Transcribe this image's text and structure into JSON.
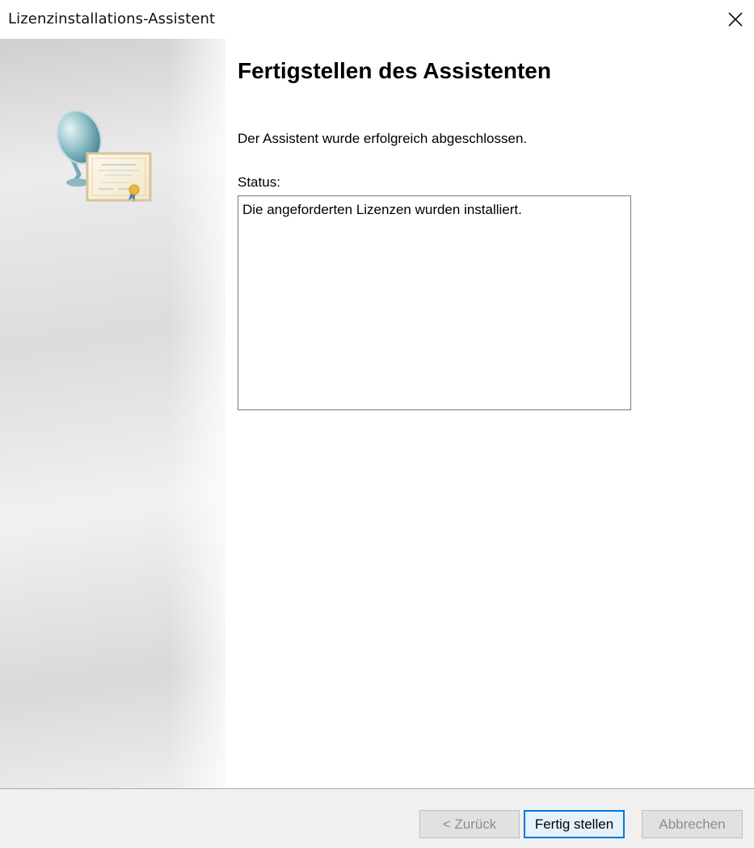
{
  "window": {
    "title": "Lizenzinstallations-Assistent",
    "close_icon": "close-icon"
  },
  "sidebar": {
    "art_icon": "license-certificate-icon"
  },
  "main": {
    "heading": "Fertigstellen des Assistenten",
    "message": "Der Assistent wurde erfolgreich abgeschlossen.",
    "status_label": "Status:",
    "status_value": "Die angeforderten Lizenzen wurden installiert."
  },
  "buttons": {
    "back": {
      "label": "< Zurück",
      "enabled": false
    },
    "finish": {
      "label": "Fertig stellen",
      "enabled": true,
      "default": true
    },
    "cancel": {
      "label": "Abbrechen",
      "enabled": false
    }
  },
  "colors": {
    "accent": "#0078d7",
    "disabled_text": "#8d8d8d",
    "footer_bg": "#f0f0f0"
  }
}
